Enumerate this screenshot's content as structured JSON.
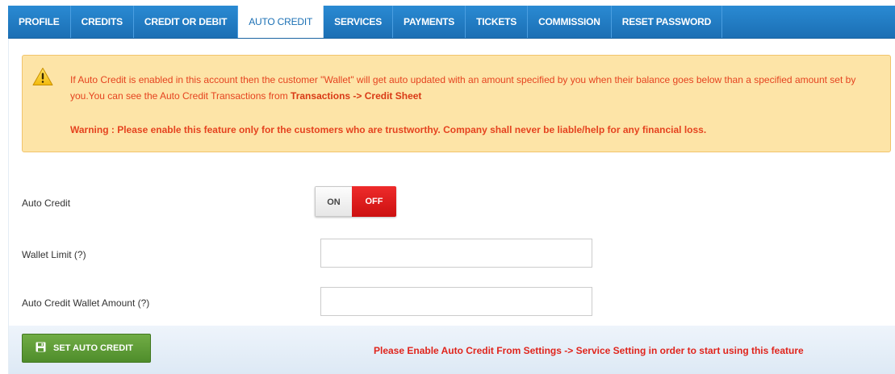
{
  "tabs": [
    {
      "label": "PROFILE"
    },
    {
      "label": "CREDITS"
    },
    {
      "label": "CREDIT OR DEBIT"
    },
    {
      "label": "AUTO CREDIT",
      "active": true
    },
    {
      "label": "SERVICES"
    },
    {
      "label": "PAYMENTS"
    },
    {
      "label": "TICKETS"
    },
    {
      "label": "COMMISSION"
    },
    {
      "label": "RESET PASSWORD"
    }
  ],
  "alert": {
    "icon": "warning-icon",
    "text_line": "If Auto Credit is enabled in this account then the customer \"Wallet\" will get auto updated with an amount specified by you when their balance goes below than a specified amount set by you.You can see the Auto Credit Transactions from ",
    "text_link": "Transactions -> Credit Sheet",
    "warning": "Warning : Please enable this feature only for the customers who are trustworthy. Company shall never be liable/help for any financial loss."
  },
  "form": {
    "auto_credit_label": "Auto Credit",
    "toggle_on": "ON",
    "toggle_off": "OFF",
    "toggle_state": "OFF",
    "wallet_limit_label": "Wallet Limit (?)",
    "wallet_limit_value": "",
    "wallet_amount_label": "Auto Credit Wallet Amount (?)",
    "wallet_amount_value": ""
  },
  "footer": {
    "button_label": "SET AUTO CREDIT",
    "button_icon": "save-icon",
    "message": "Please Enable Auto Credit From Settings -> Service Setting in order to start using this feature"
  },
  "colors": {
    "tab_bar": "#1b6fb4",
    "alert_bg": "#fde4a7",
    "alert_text": "#e5431f",
    "toggle_off": "#e01b1b",
    "button": "#5d9a36",
    "footer_message": "#e0241c"
  }
}
